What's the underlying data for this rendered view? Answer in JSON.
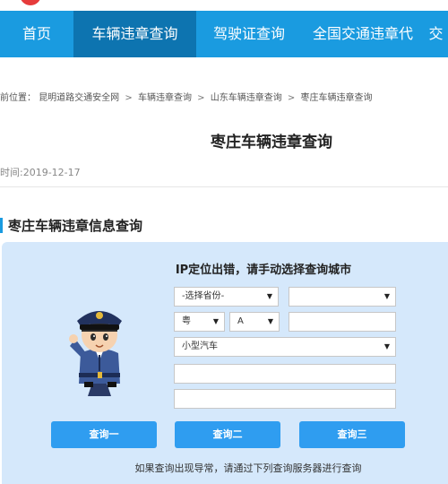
{
  "nav": {
    "items": [
      {
        "label": "首页"
      },
      {
        "label": "车辆违章查询"
      },
      {
        "label": "驾驶证查询"
      },
      {
        "label": "全国交通违章代"
      },
      {
        "label": "交"
      }
    ]
  },
  "breadcrumb": {
    "prefix": "前位置：",
    "items": [
      "昆明道路交通安全网",
      "车辆违章查询",
      "山东车辆违章查询",
      "枣庄车辆违章查询"
    ],
    "separator": ">"
  },
  "page": {
    "title": "枣庄车辆违章查询",
    "publish_time": "时间:2019-12-17"
  },
  "section": {
    "title": "枣庄车辆违章信息查询"
  },
  "form": {
    "heading": "IP定位出错，请手动选择查询城市",
    "province_select": "-选择省份-",
    "city_select": "",
    "plate_prefix": "粤",
    "plate_letter": "A",
    "plate_number": "",
    "vehicle_type": "小型汽车",
    "field_1": "",
    "field_2": "",
    "buttons": [
      "查询一",
      "查询二",
      "查询三"
    ],
    "hint": "如果查询出现导常，请通过下列查询服务器进行查询"
  },
  "colors": {
    "nav_bg": "#1a9be0",
    "nav_active": "#0d74b0",
    "panel_bg": "#d5e8fb",
    "button_bg": "#2f9df0"
  }
}
